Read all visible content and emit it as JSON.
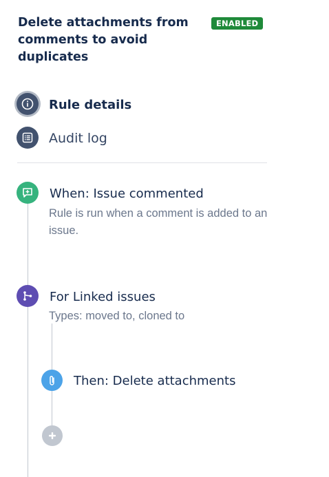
{
  "rule": {
    "title": "Delete attachments from comments to avoid duplicates",
    "status": "ENABLED"
  },
  "nav": {
    "rule_details": "Rule details",
    "audit_log": "Audit log"
  },
  "steps": {
    "trigger": {
      "title": "When: Issue commented",
      "description": "Rule is run when a comment is added to an issue."
    },
    "branch": {
      "title": "For Linked issues",
      "description": "Types: moved to, cloned to"
    },
    "action": {
      "title": "Then: Delete attachments"
    }
  },
  "colors": {
    "enabled_badge": "#1F8A3A",
    "trigger_node": "#36B37E",
    "branch_node": "#5E4DB2",
    "action_node": "#4CA3E8",
    "add_node": "#C1C7D0",
    "nav_icon_bg": "#42526E"
  },
  "icons": {
    "rule_details": "info-icon",
    "audit_log": "list-icon",
    "trigger": "comment-icon",
    "branch": "branch-icon",
    "action": "paperclip-icon",
    "add": "plus-icon"
  }
}
